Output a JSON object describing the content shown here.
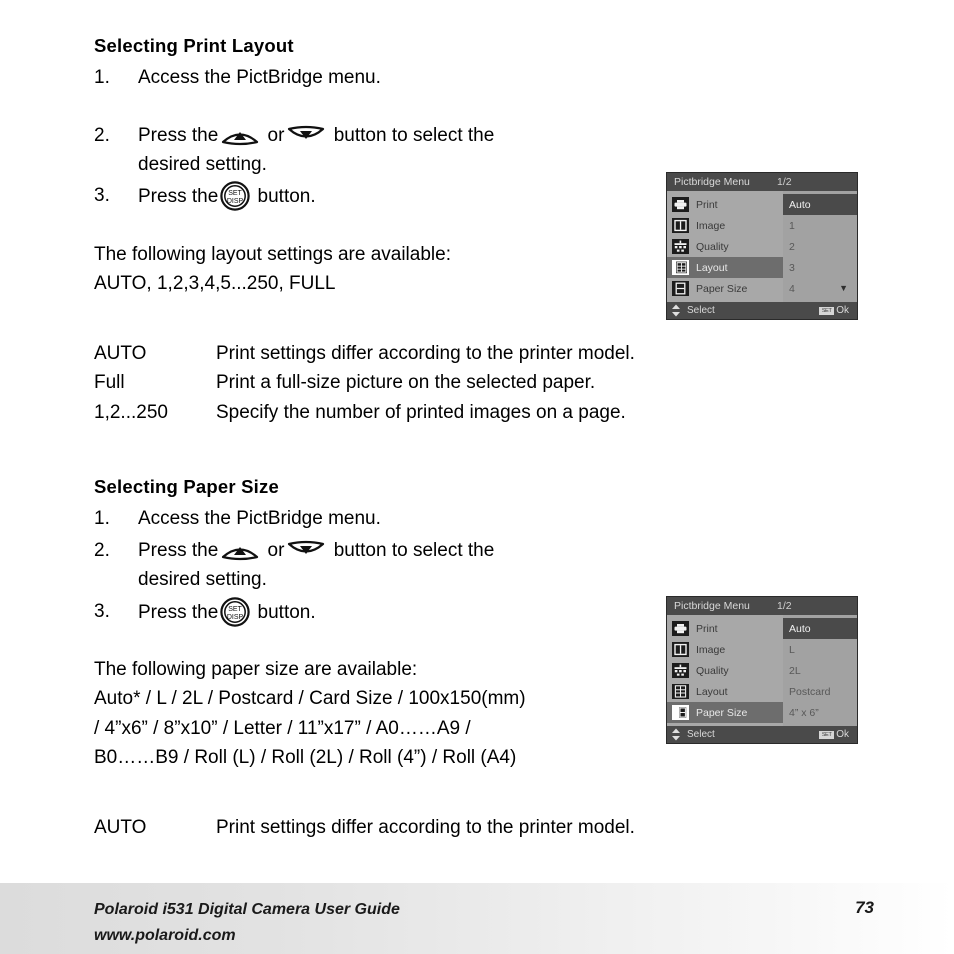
{
  "document": {
    "page_number": "73"
  },
  "sections": [
    {
      "id": "print-layout",
      "title": "Selecting Print Layout",
      "steps": [
        {
          "num": "1.",
          "text_before": "Access the PictBridge menu.",
          "text_after": "",
          "icons": []
        },
        {
          "num": "2.",
          "text_before": "Press the",
          "text_mid": "or",
          "text_after": "button to select the",
          "text_wrap": "desired setting.",
          "icons": [
            "arrow-up-button-icon",
            "arrow-down-button-icon"
          ]
        },
        {
          "num": "3.",
          "text_before": "Press the",
          "text_after": "button.",
          "icons": [
            "set-disp-button-icon"
          ]
        }
      ],
      "intro": "The following layout settings are available:",
      "options_line": "AUTO, 1,2,3,4,5...250, FULL",
      "definitions": [
        {
          "term": "AUTO",
          "desc": "Print settings differ according to the printer model."
        },
        {
          "term": "Full",
          "desc": "Print a full-size picture on the selected paper."
        },
        {
          "term": "1,2...250",
          "desc": "Specify the number of printed images on a page."
        }
      ]
    },
    {
      "id": "paper-size",
      "title": "Selecting Paper Size",
      "steps": [
        {
          "num": "1.",
          "text_before": "Access the PictBridge menu.",
          "text_after": "",
          "icons": []
        },
        {
          "num": "2.",
          "text_before": "Press the",
          "text_mid": "or",
          "text_after": "button to select the",
          "text_wrap": "desired setting.",
          "icons": [
            "arrow-up-button-icon",
            "arrow-down-button-icon"
          ]
        },
        {
          "num": "3.",
          "text_before": "Press the",
          "text_after": "button.",
          "icons": [
            "set-disp-button-icon"
          ]
        }
      ],
      "intro": "The following paper size are available:",
      "options_lines": [
        "Auto* / L / 2L / Postcard / Card Size / 100x150(mm)",
        "/ 4”x6” / 8”x10” / Letter / 11”x17” / A0……A9 /",
        "B0……B9 / Roll (L) / Roll (2L) / Roll (4”) / Roll (A4)"
      ],
      "definitions": [
        {
          "term": "AUTO",
          "desc": "Print settings differ according to the printer model."
        }
      ]
    }
  ],
  "lcd_layout": {
    "header_title": "Pictbridge Menu",
    "header_page": "1/2",
    "menu_items": [
      {
        "label": "Print",
        "icon": "printer-icon",
        "selected": false
      },
      {
        "label": "Image",
        "icon": "image-icon",
        "selected": false
      },
      {
        "label": "Quality",
        "icon": "quality-icon",
        "selected": false
      },
      {
        "label": "Layout",
        "icon": "layout-icon",
        "selected": true
      },
      {
        "label": "Paper Size",
        "icon": "paper-size-icon",
        "selected": false
      }
    ],
    "values": [
      {
        "label": "Auto",
        "selected": true,
        "chevron": false
      },
      {
        "label": "1",
        "selected": false,
        "chevron": false
      },
      {
        "label": "2",
        "selected": false,
        "chevron": false
      },
      {
        "label": "3",
        "selected": false,
        "chevron": false
      },
      {
        "label": "4",
        "selected": false,
        "chevron": true
      }
    ],
    "footer_left": "Select",
    "footer_badge": "SET",
    "footer_ok": "Ok"
  },
  "lcd_paper": {
    "header_title": "Pictbridge Menu",
    "header_page": "1/2",
    "menu_items": [
      {
        "label": "Print",
        "icon": "printer-icon",
        "selected": false
      },
      {
        "label": "Image",
        "icon": "image-icon",
        "selected": false
      },
      {
        "label": "Quality",
        "icon": "quality-icon",
        "selected": false
      },
      {
        "label": "Layout",
        "icon": "layout-icon",
        "selected": false
      },
      {
        "label": "Paper Size",
        "icon": "paper-size-icon",
        "selected": true
      }
    ],
    "values": [
      {
        "label": "Auto",
        "selected": true,
        "chevron": false
      },
      {
        "label": "L",
        "selected": false,
        "chevron": false
      },
      {
        "label": "2L",
        "selected": false,
        "chevron": false
      },
      {
        "label": "Postcard",
        "selected": false,
        "chevron": false
      },
      {
        "label": "4” x 6”",
        "selected": false,
        "chevron": false
      }
    ],
    "footer_left": "Select",
    "footer_badge": "SET",
    "footer_ok": "Ok"
  },
  "footer": {
    "line1": "Polaroid i531 Digital Camera User Guide",
    "line2": "www.polaroid.com",
    "page": "73"
  },
  "colors": {
    "lcd_bg": "#6f6f6f",
    "lcd_header": "#4a4a4a",
    "lcd_left": "#a8a8a8",
    "lcd_right": "#a2a2a2",
    "lcd_selected_row": "#6d6d6d",
    "lcd_selected_value": "#4a4a4a",
    "text": "#000000"
  }
}
